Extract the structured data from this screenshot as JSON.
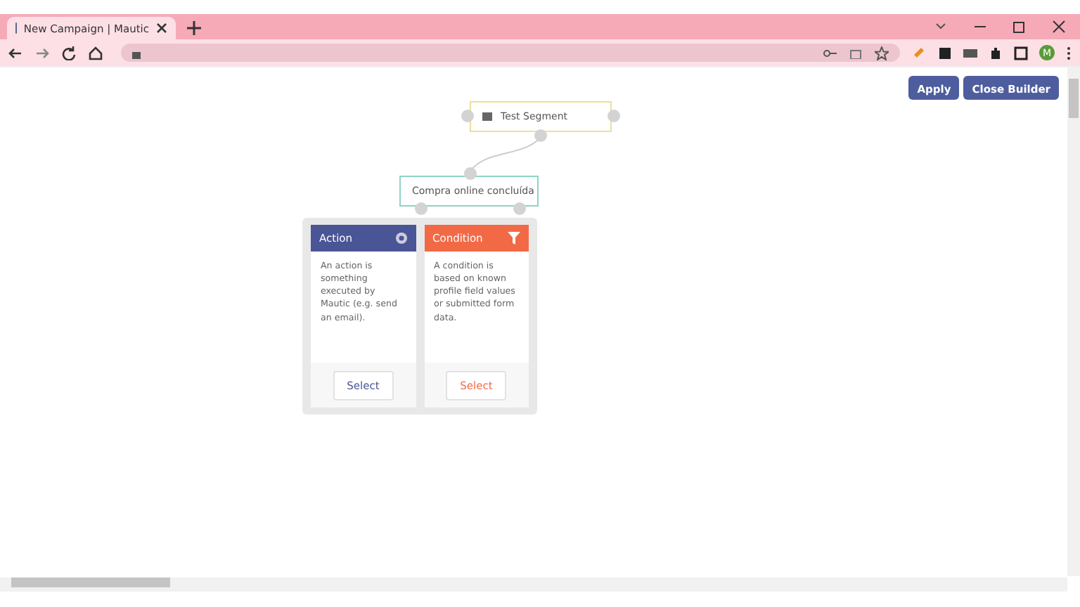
{
  "browser": {
    "tab": {
      "title": "New Campaign | Mautic"
    },
    "profile_initial": "M"
  },
  "toolbar": {
    "buttons": [
      "Apply",
      "Close Builder"
    ]
  },
  "canvas": {
    "nodes": [
      {
        "kind": "source",
        "label": "Test Segment"
      },
      {
        "kind": "decision",
        "label": "Compra online concluída"
      }
    ],
    "picker": [
      {
        "kind": "action",
        "title": "Action",
        "description": "An action is something executed by Mautic (e.g. send an email).",
        "button": "Select"
      },
      {
        "kind": "condition",
        "title": "Condition",
        "description": "A condition is based on known profile field values or submitted form data.",
        "button": "Select"
      }
    ]
  }
}
